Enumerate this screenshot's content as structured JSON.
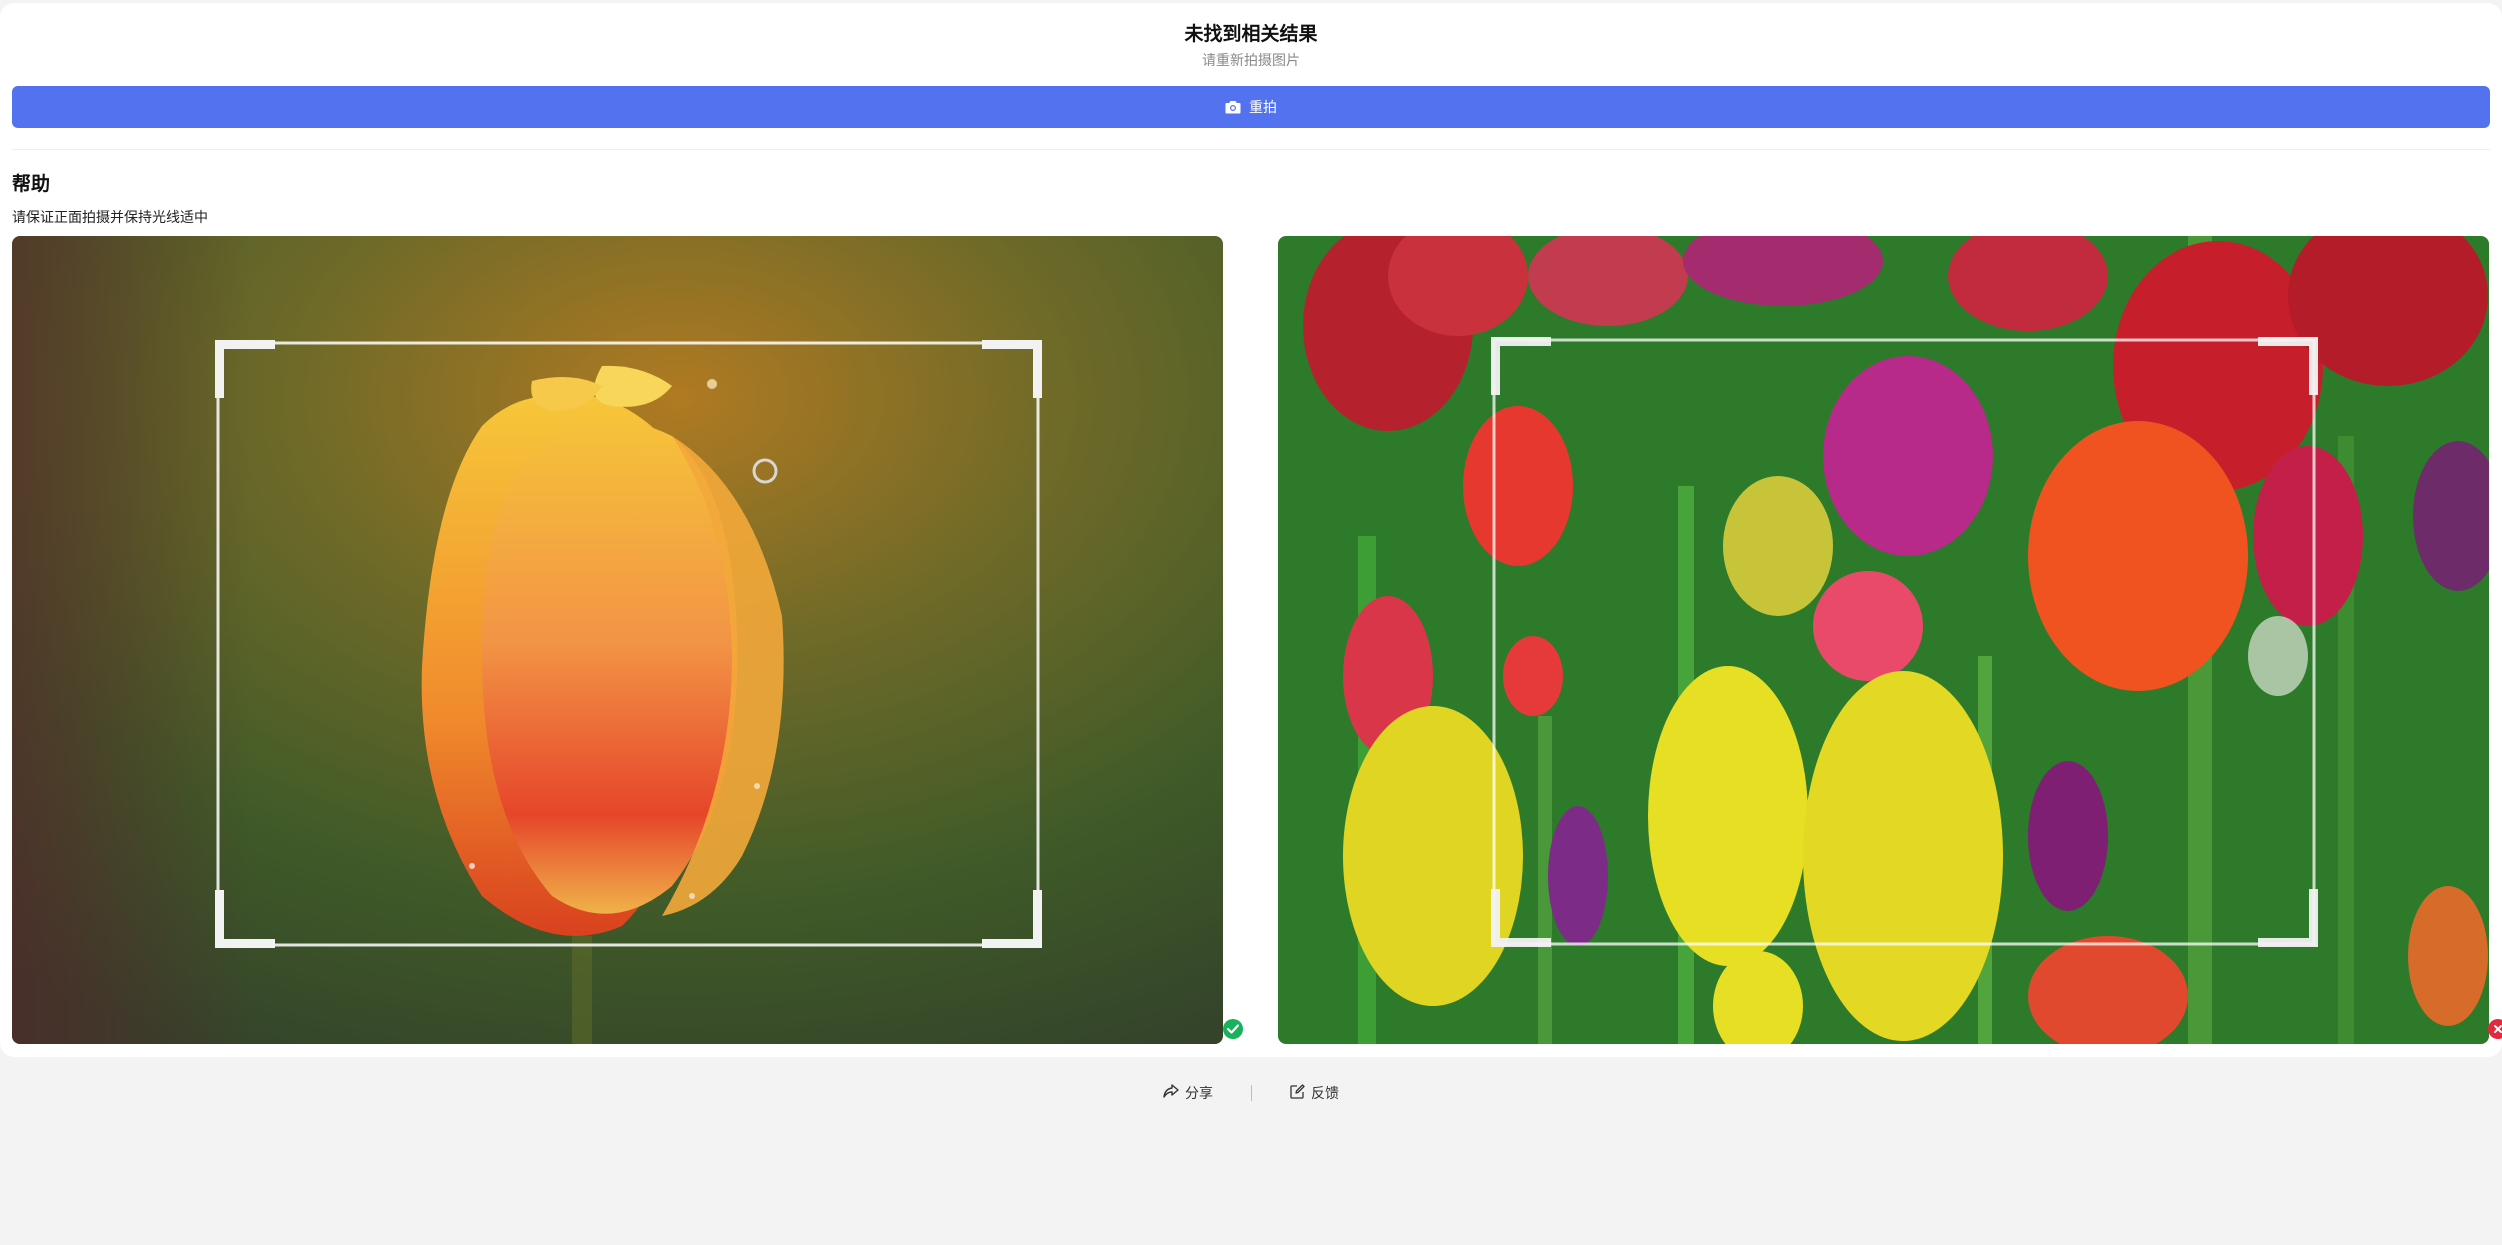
{
  "result": {
    "title": "未找到相关结果",
    "subtitle": "请重新拍摄图片"
  },
  "retake_button": {
    "label": "重拍",
    "icon": "camera-icon",
    "color": "#5272f0"
  },
  "help": {
    "title": "帮助",
    "description": "请保证正面拍摄并保持光线适中"
  },
  "examples": [
    {
      "subject": "single-yellow-red-tulip",
      "status": "correct",
      "status_icon": "check-circle-icon",
      "status_color": "#16b35c"
    },
    {
      "subject": "tulip-field-many-flowers",
      "status": "incorrect",
      "status_icon": "close-circle-icon",
      "status_color": "#e5283b"
    }
  ],
  "footer": {
    "share_label": "分享",
    "share_icon": "share-icon",
    "feedback_label": "反馈",
    "feedback_icon": "edit-icon"
  }
}
